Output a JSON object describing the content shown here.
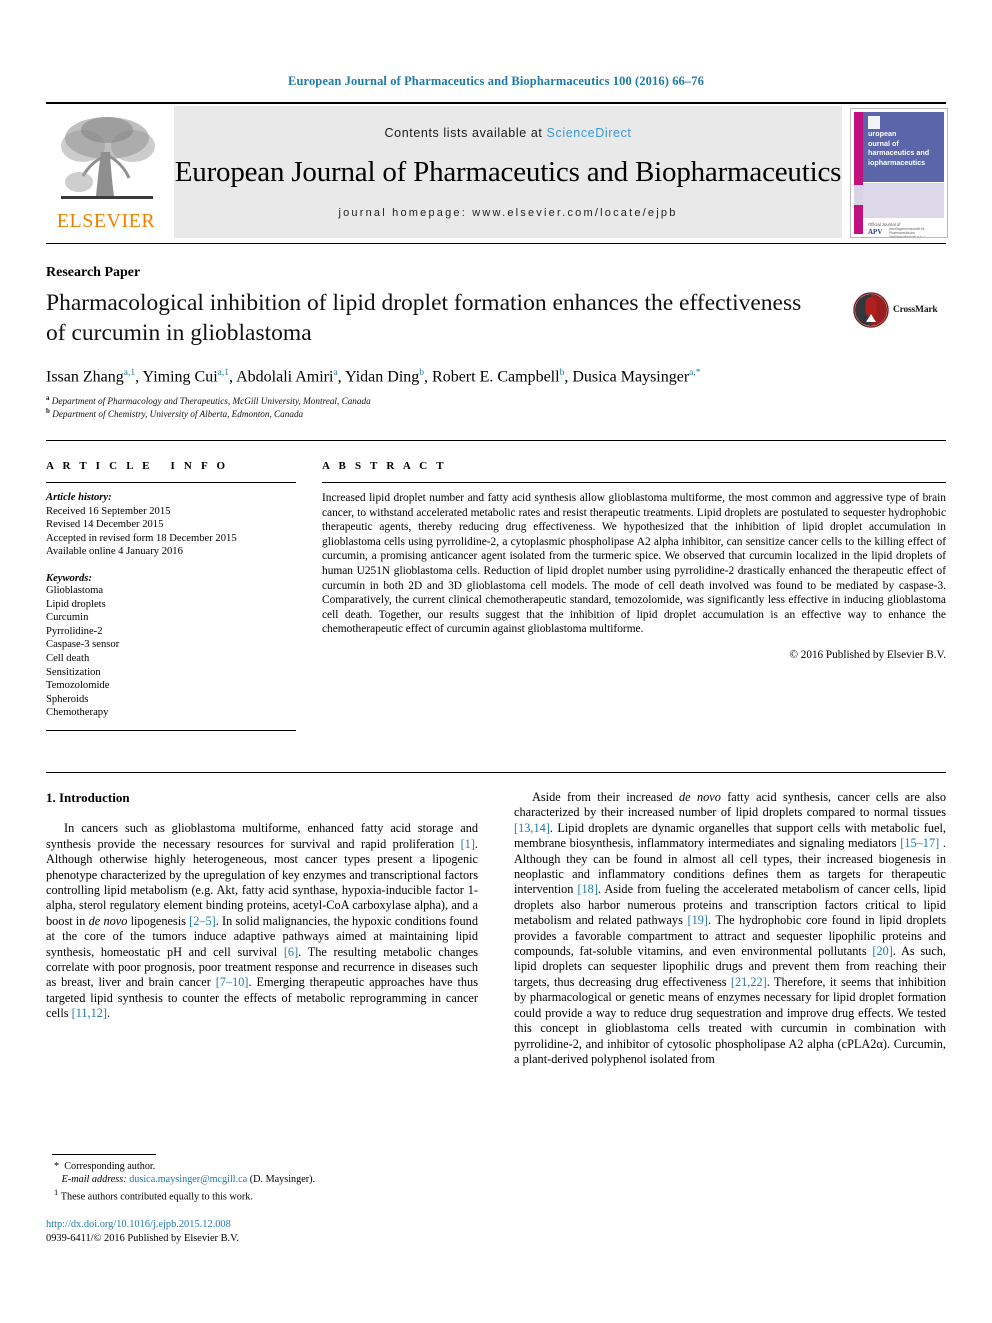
{
  "running_head": "European Journal of Pharmaceutics and Biopharmaceutics 100 (2016) 66–76",
  "masthead": {
    "publisher_logo_text": "ELSEVIER",
    "contents_prefix": "Contents lists available at ",
    "contents_link": "ScienceDirect",
    "journal_title": "European Journal of Pharmaceutics and Biopharmaceutics",
    "homepage_line": "journal homepage: www.elsevier.com/locate/ejpb",
    "cover": {
      "title_lines": [
        "uropean",
        "ournal of",
        "harmaceutics and",
        "iopharmaceutics"
      ],
      "open_access_note": "Official Journal of",
      "society_abbrev": "APV",
      "society_name": "Arbeitsgemeinschaft für Pharmazeutische Verfahrenstechnik e.V. / International Association for Pharmaceutical Technology"
    }
  },
  "article": {
    "doctype": "Research Paper",
    "title": "Pharmacological inhibition of lipid droplet formation enhances the effectiveness of curcumin in glioblastoma",
    "crossmark_label": "CrossMark",
    "authors_html": "Issan Zhang<sup>a,1</sup>, Yiming Cui<sup>a,1</sup>, Abdolali Amiri<sup>a</sup>, Yidan Ding<sup>b</sup>, Robert E. Campbell<sup>b</sup>, Dusica Maysinger<sup>a,*</sup>",
    "affiliation_a": "Department of Pharmacology and Therapeutics, McGill University, Montreal, Canada",
    "affiliation_b": "Department of Chemistry, University of Alberta, Edmonton, Canada"
  },
  "article_info": {
    "heading": "ARTICLE INFO",
    "history_label": "Article history:",
    "history": [
      "Received 16 September 2015",
      "Revised 14 December 2015",
      "Accepted in revised form 18 December 2015",
      "Available online 4 January 2016"
    ],
    "keywords_label": "Keywords:",
    "keywords": [
      "Glioblastoma",
      "Lipid droplets",
      "Curcumin",
      "Pyrrolidine-2",
      "Caspase-3 sensor",
      "Cell death",
      "Sensitization",
      "Temozolomide",
      "Spheroids",
      "Chemotherapy"
    ]
  },
  "abstract": {
    "heading": "ABSTRACT",
    "text": "Increased lipid droplet number and fatty acid synthesis allow glioblastoma multiforme, the most common and aggressive type of brain cancer, to withstand accelerated metabolic rates and resist therapeutic treatments. Lipid droplets are postulated to sequester hydrophobic therapeutic agents, thereby reducing drug effectiveness. We hypothesized that the inhibition of lipid droplet accumulation in glioblastoma cells using pyrrolidine-2, a cytoplasmic phospholipase A2 alpha inhibitor, can sensitize cancer cells to the killing effect of curcumin, a promising anticancer agent isolated from the turmeric spice. We observed that curcumin localized in the lipid droplets of human U251N glioblastoma cells. Reduction of lipid droplet number using pyrrolidine-2 drastically enhanced the therapeutic effect of curcumin in both 2D and 3D glioblastoma cell models. The mode of cell death involved was found to be mediated by caspase-3. Comparatively, the current clinical chemotherapeutic standard, temozolomide, was significantly less effective in inducing glioblastoma cell death. Together, our results suggest that the inhibition of lipid droplet accumulation is an effective way to enhance the chemotherapeutic effect of curcumin against glioblastoma multiforme.",
    "copyright": "© 2016 Published by Elsevier B.V."
  },
  "body": {
    "section_title": "1. Introduction",
    "left_paragraphs_html": [
      "In cancers such as glioblastoma multiforme, enhanced fatty acid storage and synthesis provide the necessary resources for survival and rapid proliferation <span class=\"ref\">[1]</span>. Although otherwise highly heterogeneous, most cancer types present a lipogenic phenotype characterized by the upregulation of key enzymes and transcriptional factors controlling lipid metabolism (e.g. Akt, fatty acid synthase, hypoxia-inducible factor 1-alpha, sterol regulatory element binding proteins, acetyl-CoA carboxylase alpha), and a boost in <span class=\"it\">de novo</span> lipogenesis <span class=\"ref\">[2–5]</span>. In solid malignancies, the hypoxic conditions found at the core of the tumors induce adaptive pathways aimed at maintaining lipid synthesis, homeostatic pH and cell survival <span class=\"ref\">[6]</span>. The resulting metabolic changes correlate with poor prognosis, poor treatment response and recurrence in diseases such as breast, liver and brain cancer <span class=\"ref\">[7–10]</span>. Emerging therapeutic approaches have thus targeted lipid synthesis to counter the effects of metabolic reprogramming in cancer cells <span class=\"ref\">[11,12]</span>."
    ],
    "right_paragraphs_html": [
      "Aside from their increased <span class=\"it\">de novo</span> fatty acid synthesis, cancer cells are also characterized by their increased number of lipid droplets compared to normal tissues <span class=\"ref\">[13,14]</span>. Lipid droplets are dynamic organelles that support cells with metabolic fuel, membrane biosynthesis, inflammatory intermediates and signaling mediators <span class=\"ref\">[15–17]</span> . Although they can be found in almost all cell types, their increased biogenesis in neoplastic and inflammatory conditions defines them as targets for therapeutic intervention <span class=\"ref\">[18]</span>. Aside from fueling the accelerated metabolism of cancer cells, lipid droplets also harbor numerous proteins and transcription factors critical to lipid metabolism and related pathways <span class=\"ref\">[19]</span>. The hydrophobic core found in lipid droplets provides a favorable compartment to attract and sequester lipophilic proteins and compounds, fat-soluble vitamins, and even environmental pollutants <span class=\"ref\">[20]</span>. As such, lipid droplets can sequester lipophilic drugs and prevent them from reaching their targets, thus decreasing drug effectiveness <span class=\"ref\">[21,22]</span>. Therefore, it seems that inhibition by pharmacological or genetic means of enzymes necessary for lipid droplet formation could provide a way to reduce drug sequestration and improve drug effects. We tested this concept in glioblastoma cells treated with curcumin in combination with pyrrolidine-2, and inhibitor of cytosolic phospholipase A2 alpha (cPLA2α). Curcumin, a plant-derived polyphenol isolated from"
    ]
  },
  "footnotes": {
    "corresponding": "Corresponding author.",
    "email_label": "E-mail address:",
    "email": "dusica.maysinger@mcgill.ca",
    "email_suffix": "(D. Maysinger).",
    "equal_contrib_marker": "1",
    "equal_contrib": "These authors contributed equally to this work.",
    "doi_url": "http://dx.doi.org/10.1016/j.ejpb.2015.12.008",
    "issn_line": "0939-6411/© 2016 Published by Elsevier B.V."
  },
  "colors": {
    "link_blue": "#1f7aa8",
    "sciencedirect_blue": "#3a9ad9",
    "elsevier_orange": "#F08000",
    "cover_blue": "#5a65aa",
    "cover_magenta": "#c0117e"
  }
}
